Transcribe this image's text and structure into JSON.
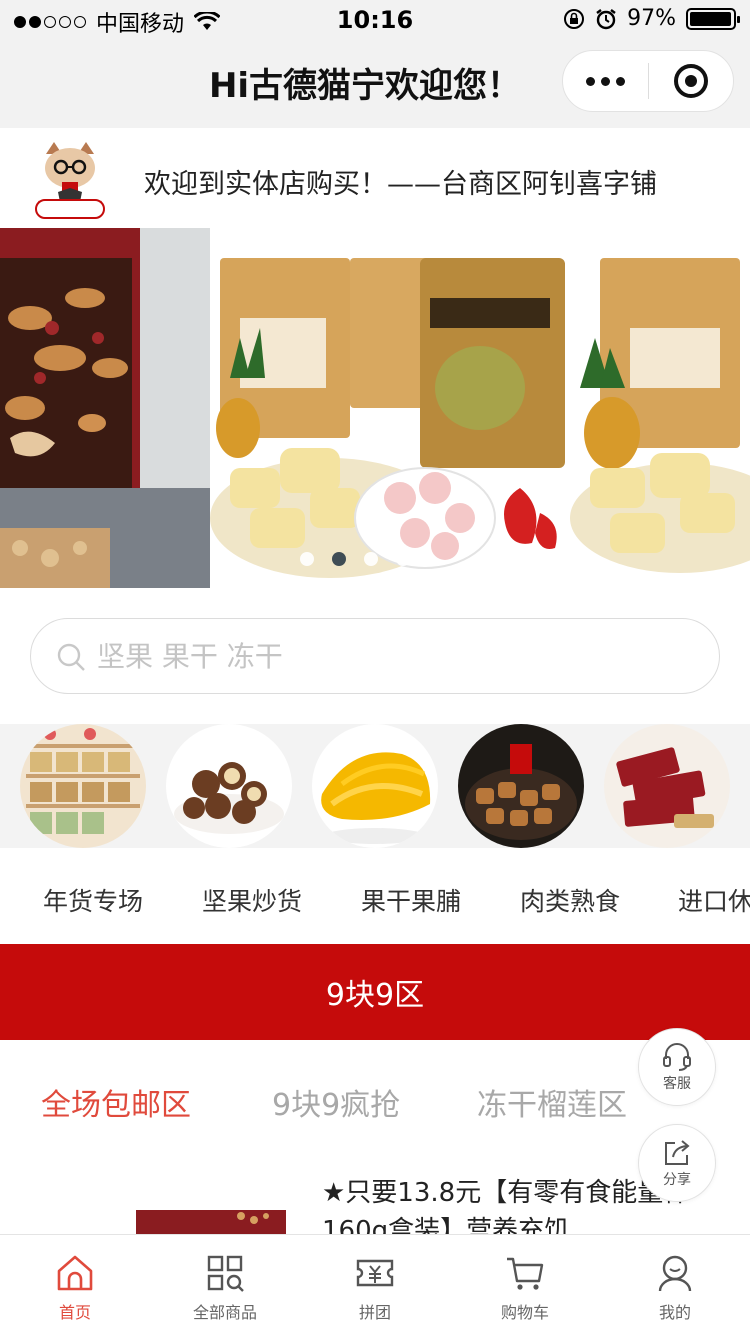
{
  "status_bar": {
    "carrier": "中国移动",
    "time": "10:16",
    "battery": "97%",
    "battery_level": 0.97
  },
  "nav": {
    "title": "Hi古德猫宁欢迎您！"
  },
  "welcome": {
    "text": "欢迎到实体店购买！——台商区阿钊喜字铺"
  },
  "search": {
    "placeholder": "坚果 果干 冻干"
  },
  "categories": [
    {
      "label": "年货专场"
    },
    {
      "label": "坚果炒货"
    },
    {
      "label": "果干果脯"
    },
    {
      "label": "肉类熟食"
    },
    {
      "label": "进口休"
    }
  ],
  "promo_banner": {
    "label": "9块9区"
  },
  "promo_tabs": [
    {
      "label": "全场包邮区"
    },
    {
      "label": "9块9疯抢"
    },
    {
      "label": "冻干榴莲区"
    }
  ],
  "product": {
    "title": "★只要13.8元【有零有食能量棒160g盒装】营养充饥"
  },
  "float_buttons": {
    "service": "客服",
    "share": "分享"
  },
  "tab_bar": [
    {
      "label": "首页"
    },
    {
      "label": "全部商品"
    },
    {
      "label": "拼团"
    },
    {
      "label": "购物车"
    },
    {
      "label": "我的"
    }
  ],
  "colors": {
    "brand_red": "#c50b0b",
    "active_tab": "#e04a3c"
  }
}
